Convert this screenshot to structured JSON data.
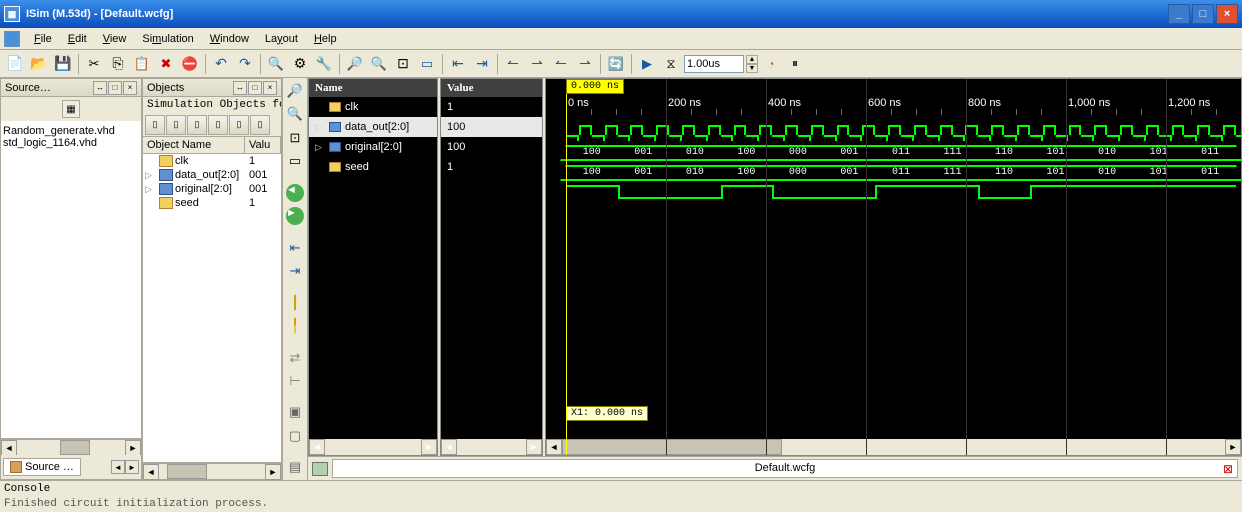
{
  "window": {
    "title": "ISim (M.53d) - [Default.wcfg]"
  },
  "menu": {
    "file": "File",
    "edit": "Edit",
    "view": "View",
    "simulation": "Simulation",
    "window": "Window",
    "layout": "Layout",
    "help": "Help"
  },
  "toolbar": {
    "time_value": "1.00us"
  },
  "source_panel": {
    "title": "Source…",
    "tab": "Source …",
    "files": [
      "Random_generate.vhd",
      "std_logic_1164.vhd"
    ]
  },
  "objects_panel": {
    "title": "Objects",
    "subtitle": "Simulation Objects for …",
    "columns": {
      "name": "Object Name",
      "value": "Valu"
    },
    "rows": [
      {
        "name": "clk",
        "value": "1",
        "type": "sig"
      },
      {
        "name": "data_out[2:0]",
        "value": "001",
        "type": "bus"
      },
      {
        "name": "original[2:0]",
        "value": "001",
        "type": "bus"
      },
      {
        "name": "seed",
        "value": "1",
        "type": "sig"
      }
    ]
  },
  "waveform": {
    "name_header": "Name",
    "value_header": "Value",
    "time_marker": "0.000 ns",
    "tooltip": "X1: 0.000 ns",
    "signals": [
      {
        "name": "clk",
        "value": "1",
        "type": "sig"
      },
      {
        "name": "data_out[2:0]",
        "value": "100",
        "type": "bus",
        "selected": true
      },
      {
        "name": "original[2:0]",
        "value": "100",
        "type": "bus"
      },
      {
        "name": "seed",
        "value": "1",
        "type": "sig"
      }
    ],
    "ruler_ticks": [
      "0 ns",
      "200 ns",
      "400 ns",
      "600 ns",
      "800 ns",
      "1,000 ns",
      "1,200 ns"
    ],
    "bus_segments": [
      "100",
      "001",
      "010",
      "100",
      "000",
      "001",
      "011",
      "111",
      "110",
      "101",
      "010",
      "101",
      "011"
    ]
  },
  "doc_tab": {
    "label": "Default.wcfg"
  },
  "console": {
    "title": "Console",
    "cut_line": "Finished circuit initialization process."
  }
}
